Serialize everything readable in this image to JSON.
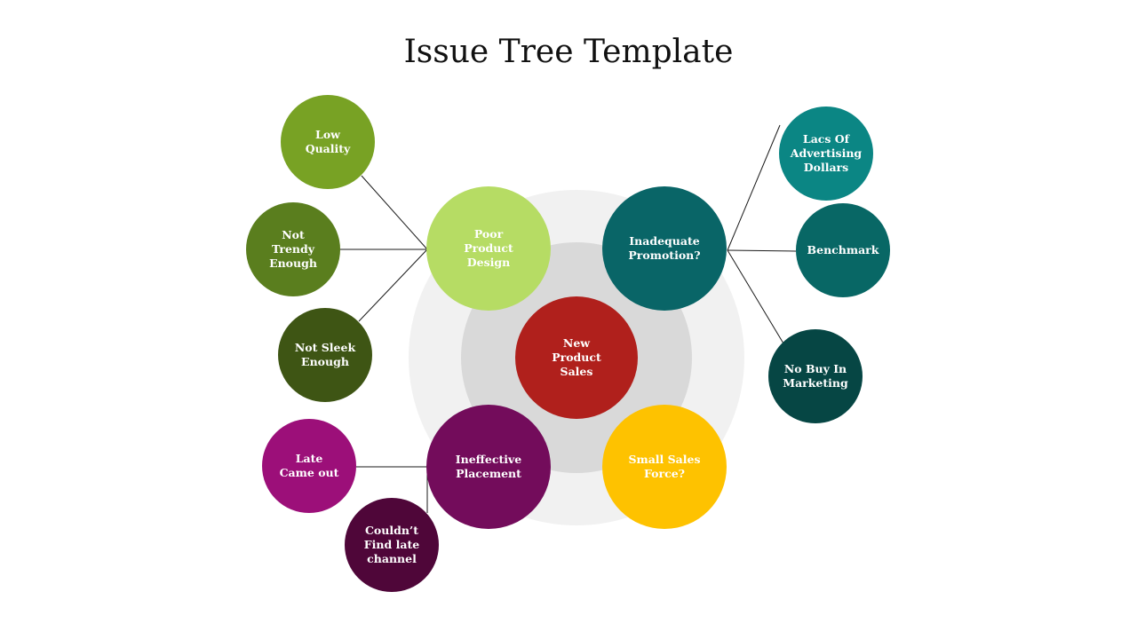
{
  "title": "Issue Tree Template",
  "colors": {
    "outer_ring": "#f1f1f1",
    "inner_ring": "#d9d9d9",
    "connector": "#1a1a1a"
  },
  "root": {
    "id": "new-product-sales",
    "label": "New\nProduct\nSales",
    "color": "#b0201c"
  },
  "branches": [
    {
      "id": "poor-product-design",
      "label": "Poor\nProduct\nDesign",
      "color": "#b6dc64",
      "children": [
        {
          "id": "low-quality",
          "label": "Low\nQuality",
          "color": "#78a224"
        },
        {
          "id": "not-trendy-enough",
          "label": "Not\nTrendy\nEnough",
          "color": "#5a7e1e"
        },
        {
          "id": "not-sleek-enough",
          "label": "Not Sleek\nEnough",
          "color": "#3e5514"
        }
      ]
    },
    {
      "id": "inadequate-promotion",
      "label": "Inadequate\nPromotion?",
      "color": "#096567",
      "children": [
        {
          "id": "lacs-of-advertising-dollars",
          "label": "Lacs Of\nAdvertising\nDollars",
          "color": "#0b8684"
        },
        {
          "id": "benchmark",
          "label": "Benchmark",
          "color": "#086765"
        },
        {
          "id": "no-buy-in-marketing",
          "label": "No Buy In\nMarketing",
          "color": "#064644"
        }
      ]
    },
    {
      "id": "ineffective-placement",
      "label": "Ineffective\nPlacement",
      "color": "#730c5b",
      "children": [
        {
          "id": "late-came-out",
          "label": "Late\nCame out",
          "color": "#9c0f79"
        },
        {
          "id": "couldnt-find-late-channel",
          "label": "Couldn’t\nFind late\nchannel",
          "color": "#4f0639"
        }
      ]
    },
    {
      "id": "small-sales-force",
      "label": "Small Sales\nForce?",
      "color": "#fec200",
      "children": []
    }
  ]
}
